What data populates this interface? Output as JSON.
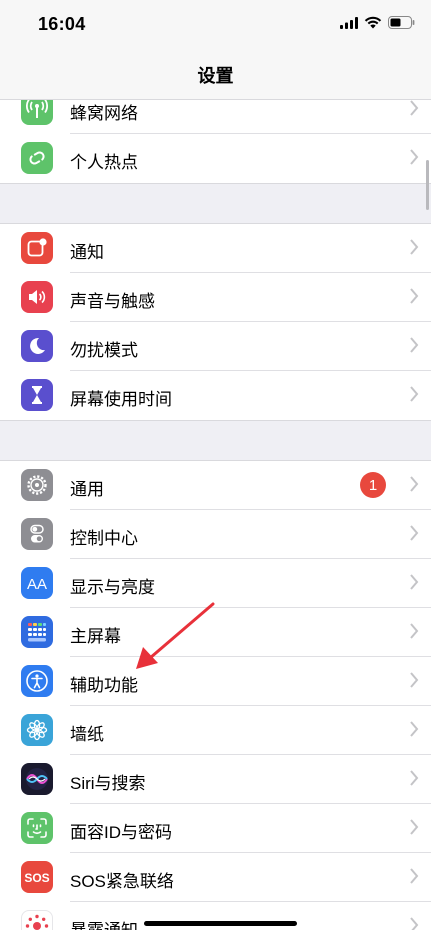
{
  "status_bar": {
    "time": "16:04"
  },
  "nav": {
    "title": "设置"
  },
  "groups": [
    {
      "items": [
        {
          "label": "蜂窝网络",
          "icon": "cellular-icon",
          "color": "#5ec36a"
        },
        {
          "label": "个人热点",
          "icon": "hotspot-icon",
          "color": "#5ec36a"
        }
      ]
    },
    {
      "items": [
        {
          "label": "通知",
          "icon": "notifications-icon",
          "color": "#e8483d"
        },
        {
          "label": "声音与触感",
          "icon": "sound-icon",
          "color": "#e8414f"
        },
        {
          "label": "勿扰模式",
          "icon": "moon-icon",
          "color": "#5a4fce"
        },
        {
          "label": "屏幕使用时间",
          "icon": "hourglass-icon",
          "color": "#5a4fce"
        }
      ]
    },
    {
      "items": [
        {
          "label": "通用",
          "icon": "gear-icon",
          "color": "#8e8e93",
          "badge": "1"
        },
        {
          "label": "控制中心",
          "icon": "toggles-icon",
          "color": "#8e8e93"
        },
        {
          "label": "显示与亮度",
          "icon": "display-icon",
          "color": "#2f7cf0"
        },
        {
          "label": "主屏幕",
          "icon": "home-screen-icon",
          "color": "#2f6be0"
        },
        {
          "label": "辅助功能",
          "icon": "accessibility-icon",
          "color": "#2f7cf0"
        },
        {
          "label": "墙纸",
          "icon": "wallpaper-icon",
          "color": "#3aa4d8"
        },
        {
          "label": "Siri与搜索",
          "icon": "siri-icon",
          "color": "#1a1a2e"
        },
        {
          "label": "面容ID与密码",
          "icon": "face-id-icon",
          "color": "#5ec36a"
        },
        {
          "label": "SOS紧急联络",
          "icon": "sos-icon",
          "color": "#e8483d"
        },
        {
          "label": "暴露通知",
          "icon": "exposure-icon",
          "color": "#ffffff"
        }
      ]
    }
  ]
}
